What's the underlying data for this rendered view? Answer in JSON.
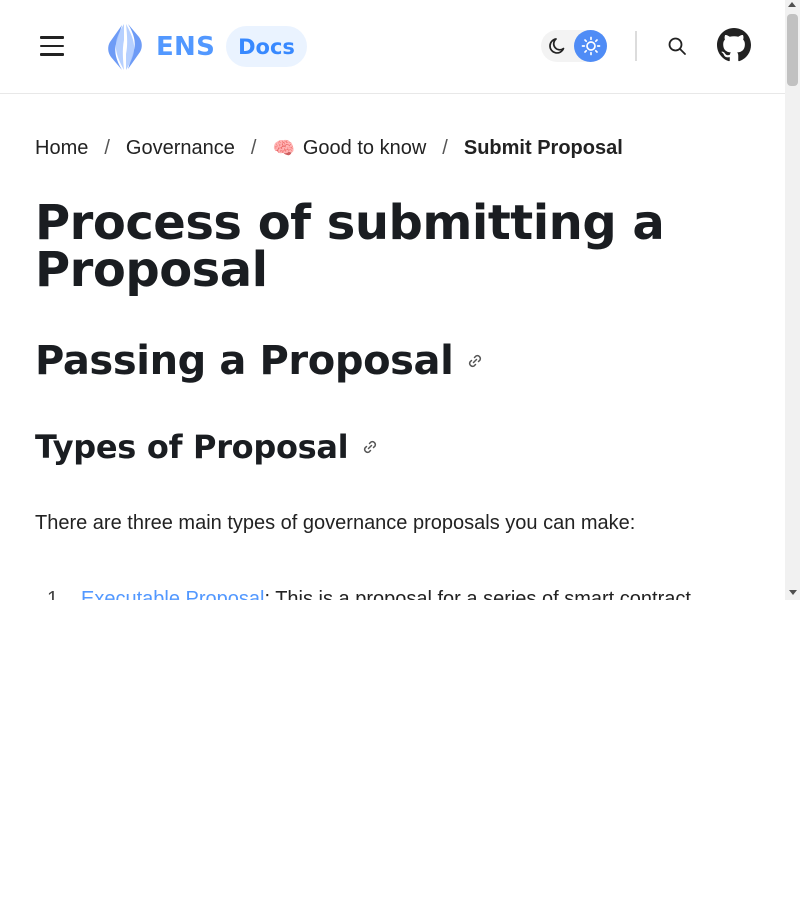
{
  "header": {
    "logo_text": "ENS",
    "docs_badge": "Docs",
    "brand_color": "#5298ff",
    "icons": [
      "menu-icon",
      "ens-logo",
      "moon-icon",
      "sun-icon",
      "search-icon",
      "github-icon"
    ]
  },
  "breadcrumb": {
    "items": [
      {
        "label": "Home"
      },
      {
        "label": "Governance"
      },
      {
        "emoji": "🧠",
        "label": "Good to know"
      },
      {
        "label": "Submit Proposal"
      }
    ],
    "separator": "/"
  },
  "content": {
    "title": "Process of submitting a Proposal",
    "h2": "Passing a Proposal",
    "h3": "Types of Proposal",
    "intro": "There are three main types of governance proposals you can make:",
    "list": [
      {
        "number": "1.",
        "link": "Executable Proposal",
        "text": ": This is a proposal for a series of smart contract"
      }
    ]
  },
  "colors": {
    "accent": "#4f8cf6",
    "docs_pill_bg": "#eaf3ff",
    "link": "#5298ff",
    "text": "#1a1d21"
  }
}
